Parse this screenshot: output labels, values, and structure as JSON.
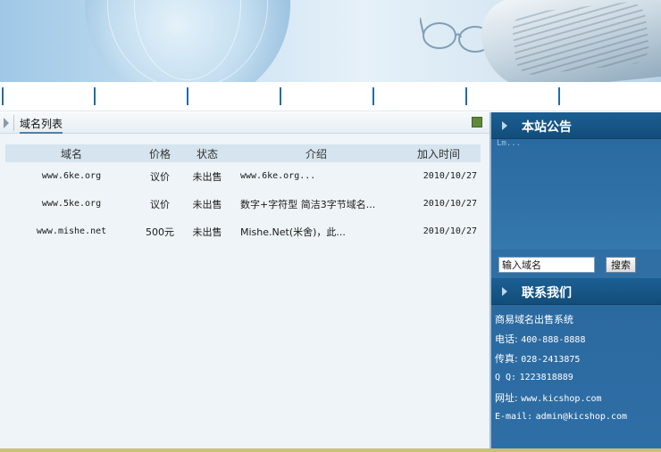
{
  "navbar": {
    "separators": 7
  },
  "domain_list": {
    "title": "域名列表",
    "columns": [
      "域名",
      "价格",
      "状态",
      "介绍",
      "加入时间"
    ],
    "rows": [
      {
        "domain": "www.6ke.org",
        "price": "议价",
        "status": "未出售",
        "intro": "www.6ke.org...",
        "date": "2010/10/27"
      },
      {
        "domain": "www.5ke.org",
        "price": "议价",
        "status": "未出售",
        "intro": "数字+字符型 简洁3字节域名...",
        "date": "2010/10/27"
      },
      {
        "domain": "www.mishe.net",
        "price": "500元",
        "status": "未出售",
        "intro": "Mishe.Net(米舍)，此...",
        "date": "2010/10/27"
      }
    ]
  },
  "notice": {
    "title": "本站公告",
    "text": "Lm..."
  },
  "search": {
    "placeholder": "输入域名",
    "value": "输入域名",
    "button_label": "搜索"
  },
  "contact": {
    "title": "联系我们",
    "site_name": "商易域名出售系统",
    "phone_label": "电话:",
    "phone": "400-888-8888",
    "fax_label": "传真:",
    "fax": "028-2413875",
    "qq_label": "Q  Q:",
    "qq": "1223818889",
    "site_label": "网址:",
    "site": "www.kicshop.com",
    "email_label": "E-mail:",
    "email": "admin@kicshop.com"
  },
  "colors": {
    "accent": "#1d6fa8",
    "panel_blue": "#2e6da0",
    "header_blue": "#134d7a",
    "table_header": "#d5e4ee"
  }
}
